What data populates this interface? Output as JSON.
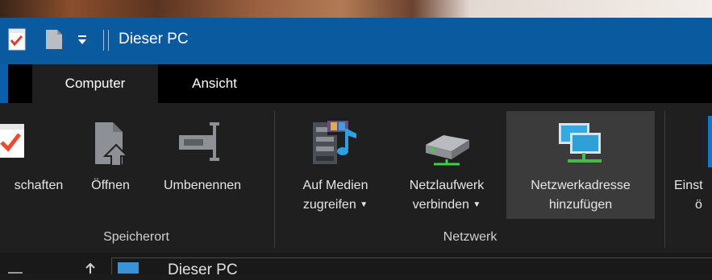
{
  "window": {
    "title": "Dieser PC"
  },
  "tabs": {
    "file": "",
    "computer": "Computer",
    "view": "Ansicht"
  },
  "ribbon": {
    "groups": {
      "location": {
        "label": "Speicherort",
        "buttons": {
          "properties": "schaften",
          "open": "Öffnen",
          "rename": "Umbenennen"
        }
      },
      "network": {
        "label": "Netzwerk",
        "buttons": {
          "access_media": {
            "line1": "Auf Medien",
            "line2": "zugreifen"
          },
          "map_network_drive": {
            "line1": "Netzlaufwerk",
            "line2": "verbinden"
          },
          "add_network_location": {
            "line1": "Netzwerkadresse",
            "line2": "hinzufügen"
          }
        }
      },
      "system": {
        "buttons": {
          "settings_partial": {
            "line1": "Einst",
            "line2": "ö"
          }
        }
      }
    }
  },
  "address_bar": {
    "value": "Dieser PC"
  },
  "colors": {
    "title_bar": "#0a5aa0",
    "ribbon_bg": "#1f1f1f",
    "accent": "#0b5ea8"
  }
}
